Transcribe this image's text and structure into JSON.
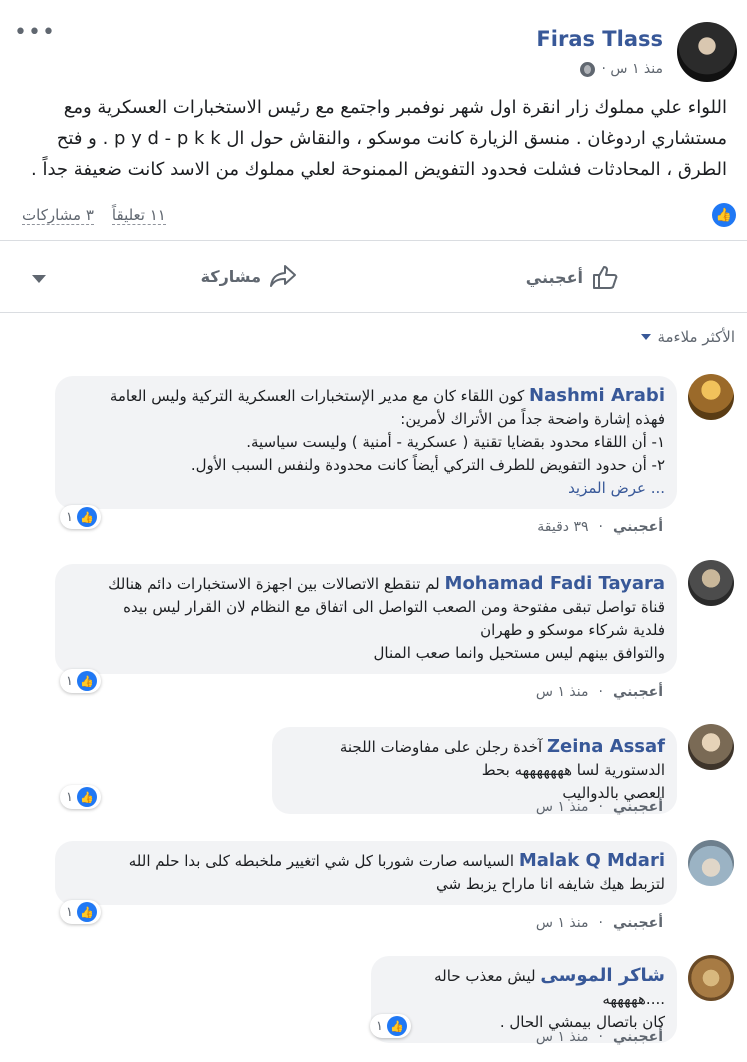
{
  "post": {
    "author": "Firas Tlass",
    "time": "منذ ١ س ·",
    "text": "اللواء علي مملوك زار انقرة اول شهر نوفمبر واجتمع مع رئيس الاستخبارات العسكرية ومع مستشاري اردوغان . منسق الزيارة كانت موسكو ، والنقاش حول ال p y d - p k k . و فتح الطرق ، المحادثات فشلت فحدود التفويض الممنوحة لعلي مملوك من الاسد كانت ضعيفة جداً .",
    "comments_count": "١١ تعليقاً",
    "shares_count": "٣ مشاركات"
  },
  "actions": {
    "like": "أعجبني",
    "share": "مشاركة"
  },
  "sort_label": "الأكثر ملاءمة",
  "comments": [
    {
      "name": "Nashmi Arabi",
      "lines": [
        "كون اللقاء كان مع مدير الإستخبارات العسكرية التركية وليس العامة",
        "فهذه إشارة واضحة جداً من الأتراك لأمرين:",
        "١- أن اللقاء محدود بقضايا تقنية ( عسكرية - أمنية ) وليست سياسية.",
        "٢- أن حدود التفويض للطرف التركي أيضاً كانت محدودة ولنفس السبب الأول."
      ],
      "see_more": "... عرض المزيد",
      "like": "أعجبني",
      "time": "٣٩ دقيقة",
      "reactions": "١"
    },
    {
      "name": "Mohamad Fadi Tayara",
      "lines": [
        "لم تنقطع الاتصالات بين اجهزة الاستخبارات دائم هنالك",
        "قناة تواصل تبقى مفتوحة ومن الصعب التواصل الى اتفاق مع النظام لان القرار ليس بيده",
        "فلدية شركاء موسكو و طهران",
        "والتوافق بينهم ليس مستحيل وانما صعب المنال"
      ],
      "like": "أعجبني",
      "time": "منذ ١ س",
      "reactions": "١"
    },
    {
      "name": "Zeina Assaf",
      "lines": [
        "آخدة رجلن على مفاوضات اللجنة الدستورية لسا هههههههه بحط",
        "العصي بالدواليب"
      ],
      "like": "أعجبني",
      "time": "منذ ١ س",
      "reactions": "١"
    },
    {
      "name": "Malak Q Mdari",
      "lines": [
        "السياسه صارت شوربا كل شي اتغيير ملخبطه كلى بدا حلم الله",
        "لتزبط هيك شايفه انا ماراح يزبط شي"
      ],
      "like": "أعجبني",
      "time": "منذ ١ س",
      "reactions": "١"
    },
    {
      "name": "شاكر الموسى",
      "lines": [
        "ليش معذب حاله ....هههههه",
        "كان باتصال بيمشي الحال ."
      ],
      "like": "أعجبني",
      "time": "منذ ١ س",
      "reactions": "١"
    }
  ],
  "colors": {
    "link": "#385898",
    "like_blue": "#2078f4",
    "bubble": "#f2f3f5"
  }
}
